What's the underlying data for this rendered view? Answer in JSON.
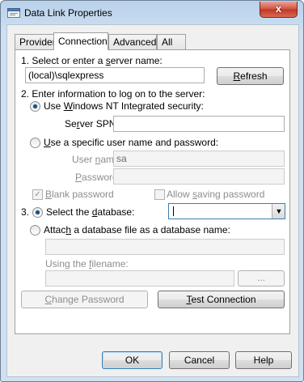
{
  "window": {
    "title": "Data Link Properties",
    "close_label": "x",
    "title_icon": "data-link-icon",
    "accent_color": "#b9d1ea",
    "close_color": "#c8412f"
  },
  "tabs": [
    {
      "label": "Provider",
      "active": false
    },
    {
      "label": "Connection",
      "active": true
    },
    {
      "label": "Advanced",
      "active": false
    },
    {
      "label": "All",
      "active": false
    }
  ],
  "step1": {
    "label_pre": "1. Select or enter a ",
    "label_key": "s",
    "label_post": "erver name:",
    "server_value": "(local)\\sqlexpress",
    "refresh_key": "R",
    "refresh_rest": "efresh"
  },
  "step2": {
    "label": "2. Enter information to log on to the server:",
    "nt_pre": "Use ",
    "nt_key": "W",
    "nt_post": "indows NT Integrated security:",
    "spn_pre": "Se",
    "spn_key": "r",
    "spn_post": "ver SPN:",
    "spn_value": "",
    "specific_key": "U",
    "specific_post": "se a specific user name and password:",
    "user_pre": "User ",
    "user_key": "n",
    "user_post": "ame:",
    "user_value": "sa",
    "password_key": "P",
    "password_post": "assword:",
    "password_value": "",
    "blank_key": "B",
    "blank_post": "lank password",
    "allow_pre": "Allow ",
    "allow_key": "s",
    "allow_post": "aving password"
  },
  "step3": {
    "number": "3.",
    "select_pre": "Select the ",
    "select_key": "d",
    "select_post": "atabase:",
    "database_value": "",
    "attach_pre": "Attac",
    "attach_key": "h",
    "attach_post": " a database file as a database name:",
    "attach_value": "",
    "filename_pre": "Using the ",
    "filename_key": "f",
    "filename_post": "ilename:",
    "filename_value": "",
    "browse_label": "..."
  },
  "actions": {
    "change_pre": "",
    "change_key": "C",
    "change_post": "hange Password",
    "test_key": "T",
    "test_post": "est Connection"
  },
  "footer": {
    "ok": "OK",
    "cancel": "Cancel",
    "help": "Help"
  },
  "state": {
    "auth_mode": "windows_nt",
    "db_mode": "select",
    "blank_password_checked": true,
    "allow_saving_checked": false
  }
}
